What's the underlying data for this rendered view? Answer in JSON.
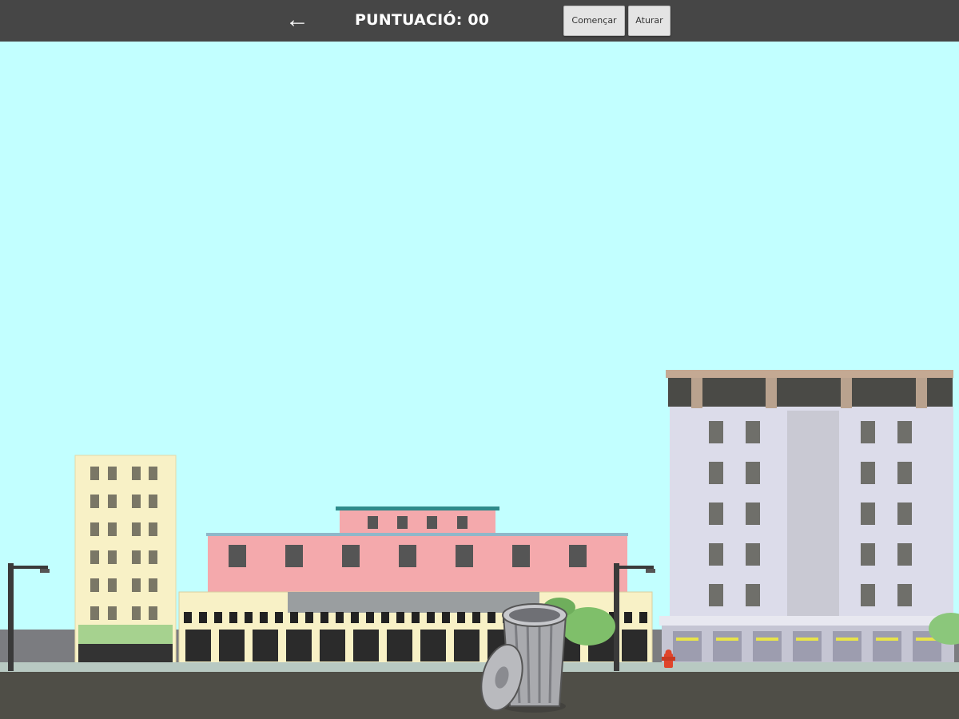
{
  "header": {
    "back_icon": "left-arrow-icon",
    "score_label": "PUNTUACIÓ:",
    "score_value": "00",
    "start_button": "Començar",
    "stop_button": "Aturar"
  },
  "colors": {
    "sky": "#c2ffff",
    "topbar": "#464646",
    "road": "#4f4e47",
    "sidewalk": "#b8c9c2",
    "pink_building": "#f4a9ac",
    "cream_building": "#f8f1c6",
    "white_building": "#dcdcea"
  },
  "scene": {
    "player": "trash-can",
    "buildings": [
      "cream-tower",
      "pink-mall",
      "grey-hotel"
    ],
    "props": [
      "street-lamp",
      "street-lamp",
      "fire-hydrant",
      "bush",
      "tree"
    ]
  }
}
